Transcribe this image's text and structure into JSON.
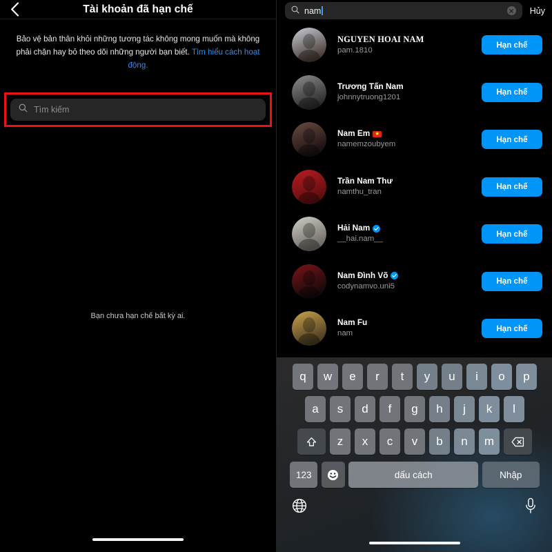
{
  "left": {
    "nav": {
      "back_icon": "chevron-left-icon",
      "title": "Tài khoản đã hạn chế"
    },
    "description": {
      "text": "Bảo vệ bản thân khỏi những tương tác không mong muốn mà không phải chặn hay bỏ theo dõi những người bạn biết. ",
      "link": "Tìm hiểu cách hoạt động."
    },
    "search": {
      "icon": "search-icon",
      "placeholder": "Tìm kiếm",
      "value": ""
    },
    "empty_state": "Bạn chưa hạn chế bất kỳ ai.",
    "highlight_color": "#ee1111"
  },
  "right": {
    "search": {
      "icon": "search-icon",
      "value": "nam",
      "clear_icon": "clear-circle-icon",
      "cancel_label": "Hủy"
    },
    "action_label": "Hạn chế",
    "accent_color": "#0095f6",
    "highlight_color": "#ee1111",
    "users": [
      {
        "name": "NGUYEN HOAI NAM",
        "handle": "pam.1810",
        "verified": false,
        "flag": false,
        "caps": true,
        "avatar_colors": [
          "#c6cdd6",
          "#4a3b34"
        ]
      },
      {
        "name": "Trương Tấn Nam",
        "handle": "johnnytruong1201",
        "verified": false,
        "flag": false,
        "caps": false,
        "avatar_colors": [
          "#8d8d8d",
          "#2a2a2a"
        ]
      },
      {
        "name": "Nam Em",
        "handle": "namemzoubyem",
        "verified": false,
        "flag": true,
        "caps": false,
        "avatar_colors": [
          "#6b4b42",
          "#1a1012"
        ]
      },
      {
        "name": "Trần Nam Thư",
        "handle": "namthu_tran",
        "verified": false,
        "flag": false,
        "caps": false,
        "avatar_colors": [
          "#b81d21",
          "#5c0d10"
        ]
      },
      {
        "name": "Hải Nam",
        "handle": "__hai.nam__",
        "verified": true,
        "flag": false,
        "caps": false,
        "avatar_colors": [
          "#cfcdc6",
          "#6e6a64"
        ]
      },
      {
        "name": "Nam Đình Võ",
        "handle": "codynamvo.uni5",
        "verified": true,
        "flag": false,
        "caps": false,
        "avatar_colors": [
          "#7a1418",
          "#14090b"
        ]
      },
      {
        "name": "Nam Fu",
        "handle": "nam",
        "verified": false,
        "flag": false,
        "caps": false,
        "avatar_colors": [
          "#c9a24a",
          "#4a3a22"
        ]
      }
    ]
  },
  "keyboard": {
    "row1": [
      "q",
      "w",
      "e",
      "r",
      "t",
      "y",
      "u",
      "i",
      "o",
      "p"
    ],
    "row2": [
      "a",
      "s",
      "d",
      "f",
      "g",
      "h",
      "j",
      "k",
      "l"
    ],
    "row3": [
      "z",
      "x",
      "c",
      "v",
      "b",
      "n",
      "m"
    ],
    "shift_icon": "shift-up-icon",
    "backspace_icon": "backspace-icon",
    "numbers_label": "123",
    "emoji_icon": "emoji-smiley-icon",
    "space_label": "dấu cách",
    "enter_label": "Nhập",
    "globe_icon": "globe-icon",
    "mic_icon": "microphone-icon"
  }
}
